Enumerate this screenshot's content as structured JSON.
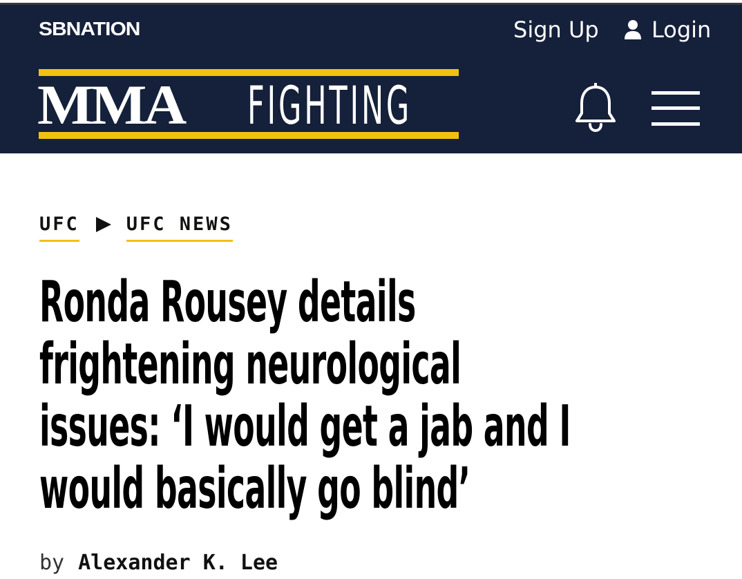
{
  "header": {
    "network_logo": "SBNATION",
    "signup_label": "Sign Up",
    "login_label": "Login",
    "brand": {
      "primary": "MMA",
      "secondary": "FIGHTING"
    },
    "icons": {
      "login": "user-icon",
      "notifications": "bell-icon",
      "menu": "hamburger-menu-icon"
    }
  },
  "breadcrumb": {
    "items": [
      {
        "label": "UFC"
      },
      {
        "label": "UFC NEWS"
      }
    ],
    "separator_icon": "play-arrow-icon"
  },
  "article": {
    "headline_lines": [
      "Ronda Rousey details",
      "frightening neurological",
      "issues: ‘I would get a jab and I",
      "would basically go blind’"
    ],
    "byline_prefix": "by",
    "author": "Alexander K. Lee"
  },
  "colors": {
    "header_background": "#15203a",
    "accent_yellow": "#f2c10f",
    "text": "#000000",
    "header_text": "#ffffff"
  }
}
